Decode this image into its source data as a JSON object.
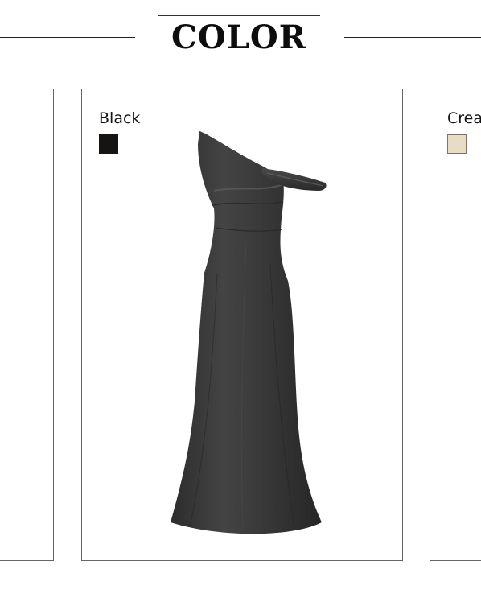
{
  "section": {
    "title": "COLOR"
  },
  "cards": [
    {
      "label": "",
      "swatch_color": ""
    },
    {
      "label": "Black",
      "swatch_color": "#151412",
      "image": "black-one-shoulder-gown"
    },
    {
      "label": "Crea",
      "swatch_color": "#e8dcc4"
    }
  ],
  "colors": {
    "rule": "#222222",
    "card_border": "#666666",
    "dress": "#3a3a3a"
  }
}
